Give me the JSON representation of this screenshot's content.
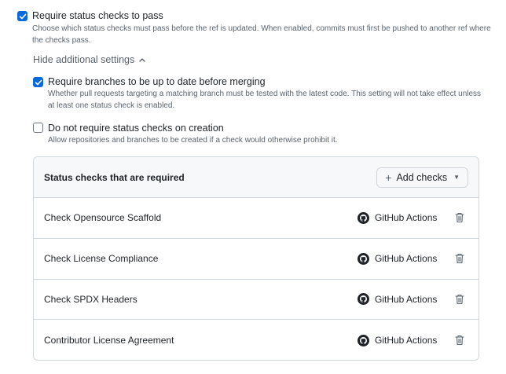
{
  "require_checks": {
    "checked": true,
    "label": "Require status checks to pass",
    "description": "Choose which status checks must pass before the ref is updated. When enabled, commits must first be pushed to another ref where the checks pass."
  },
  "toggle": {
    "label": "Hide additional settings"
  },
  "up_to_date": {
    "checked": true,
    "label": "Require branches to be up to date before merging",
    "description": "Whether pull requests targeting a matching branch must be tested with the latest code. This setting will not take effect unless at least one status check is enabled."
  },
  "no_require_on_creation": {
    "checked": false,
    "label": "Do not require status checks on creation",
    "description": "Allow repositories and branches to be created if a check would otherwise prohibit it."
  },
  "panel": {
    "title": "Status checks that are required",
    "add_button_label": "Add checks",
    "rows": [
      {
        "name": "Check Opensource Scaffold",
        "app": "GitHub Actions"
      },
      {
        "name": "Check License Compliance",
        "app": "GitHub Actions"
      },
      {
        "name": "Check SPDX Headers",
        "app": "GitHub Actions"
      },
      {
        "name": "Contributor License Agreement",
        "app": "GitHub Actions"
      }
    ]
  },
  "colors": {
    "accent": "#0969da",
    "muted_text": "#59636e",
    "border": "#d0d7de"
  }
}
